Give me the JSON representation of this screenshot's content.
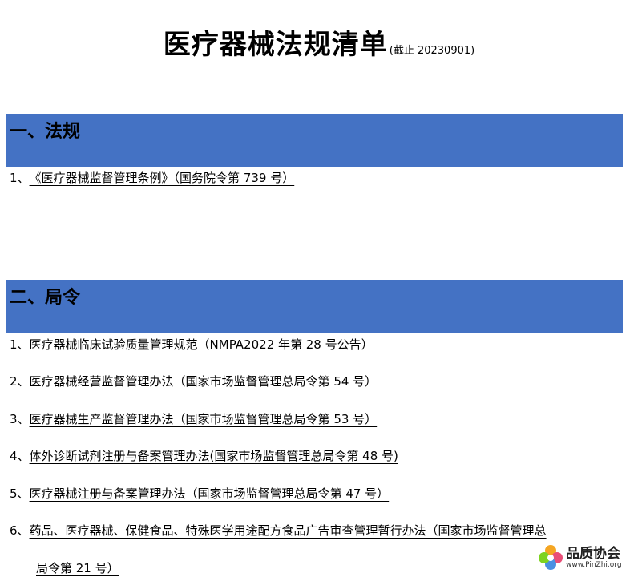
{
  "header": {
    "title": "医疗器械法规清单",
    "subtitle": "(截止 20230901)"
  },
  "sections": [
    {
      "heading": "一、法规",
      "items": [
        {
          "num": "1、",
          "text": "《医疗器械监督管理条例》（国务院令第 739 号）"
        }
      ]
    },
    {
      "heading": "二、局令",
      "items": [
        {
          "num": "1、",
          "text": "医疗器械临床试验质量管理规范（NMPA2022 年第 28 号公告）"
        },
        {
          "num": "2、",
          "text": "医疗器械经营监督管理办法（国家市场监督管理总局令第 54 号）"
        },
        {
          "num": "3、",
          "text": "医疗器械生产监督管理办法（国家市场监督管理总局令第 53 号）"
        },
        {
          "num": "4、",
          "text": "体外诊断试剂注册与备案管理办法(国家市场监督管理总局令第 48 号)"
        },
        {
          "num": "5、",
          "text": "医疗器械注册与备案管理办法（国家市场监督管理总局令第 47 号）"
        },
        {
          "num": "6、",
          "text": "药品、医疗器械、保健食品、特殊医学用途配方食品广告审查管理暂行办法（国家市场监督管理总",
          "text_cont": "局令第 21 号）"
        }
      ]
    }
  ],
  "logo": {
    "brand": "品质协会",
    "url": "www.PinZhi.org"
  },
  "colors": {
    "section_bar": "#4472c4"
  }
}
